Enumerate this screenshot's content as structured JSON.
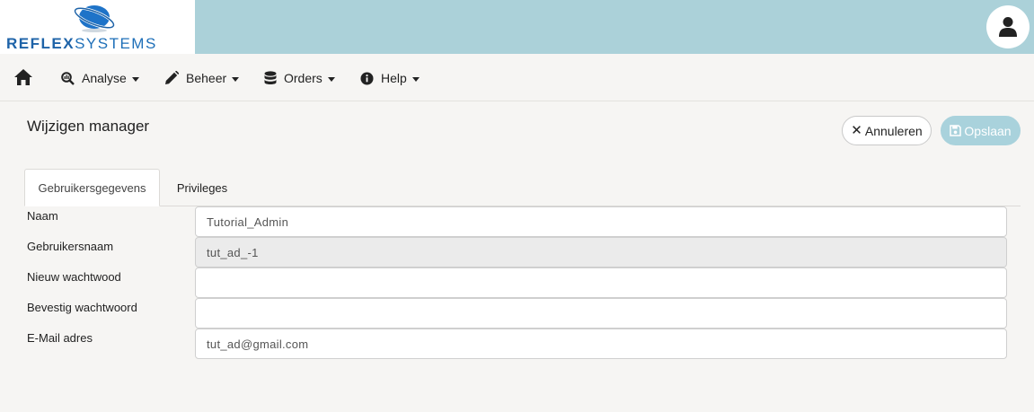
{
  "brand": {
    "logo_bold": "REFLEX",
    "logo_light": "SYSTEMS"
  },
  "nav": {
    "items": [
      {
        "label": "Analyse",
        "icon": "search-chart-icon"
      },
      {
        "label": "Beheer",
        "icon": "pencil-icon"
      },
      {
        "label": "Orders",
        "icon": "database-icon"
      },
      {
        "label": "Help",
        "icon": "info-icon"
      }
    ]
  },
  "page": {
    "title": "Wijzigen manager",
    "cancel_label": "Annuleren",
    "save_label": "Opslaan"
  },
  "tabs": [
    {
      "label": "Gebruikersgegevens",
      "active": true
    },
    {
      "label": "Privileges",
      "active": false
    }
  ],
  "form": {
    "fields": [
      {
        "label": "Naam",
        "value": "Tutorial_Admin",
        "readonly": false
      },
      {
        "label": "Gebruikersnaam",
        "value": "tut_ad_-1",
        "readonly": true
      },
      {
        "label": "Nieuw wachtwood",
        "value": "",
        "readonly": false
      },
      {
        "label": "Bevestig wachtwoord",
        "value": "",
        "readonly": false
      },
      {
        "label": "E-Mail adres",
        "value": "tut_ad@gmail.com",
        "readonly": false
      }
    ]
  },
  "colors": {
    "header_bg": "#abd1d9",
    "brand_blue": "#1e63a8",
    "save_button": "#a9d2dc"
  }
}
